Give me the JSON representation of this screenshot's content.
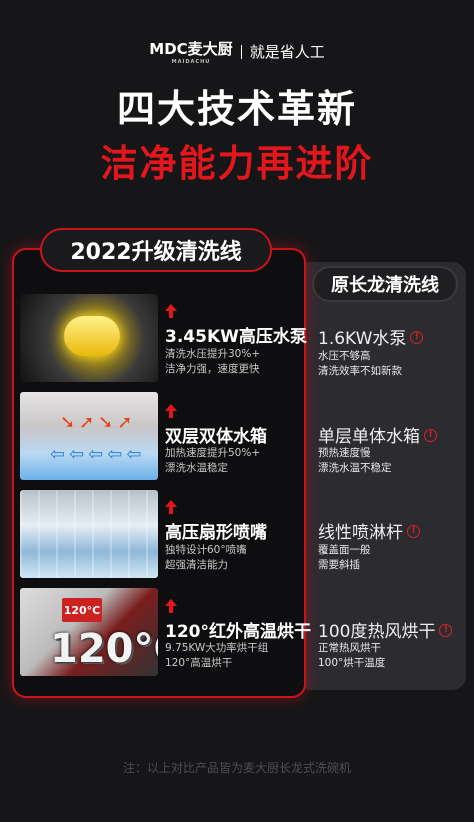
{
  "brand": {
    "logo": "MDC麦大厨",
    "logo_sub": "MAIDACHU",
    "slogan": "就是省人工"
  },
  "headline": {
    "line1": "四大技术革新",
    "line2": "洁净能力再进阶"
  },
  "new_line": {
    "label": "2022升级清洗线",
    "items": [
      {
        "title": "3.45KW高压水泵",
        "sub1": "清洗水压提升30%+",
        "sub2": "洁净力强，速度更快"
      },
      {
        "title": "双层双体水箱",
        "sub1": "加热速度提升50%+",
        "sub2": "漂洗水温稳定"
      },
      {
        "title": "高压扇形喷嘴",
        "sub1": "独特设计60°喷嘴",
        "sub2": "超强清洁能力"
      },
      {
        "title": "120°红外高温烘干",
        "sub1": "9.75KW大功率烘干组",
        "sub2": "120°高温烘干"
      }
    ],
    "image_texts": {
      "temp_big": "120°C",
      "temp_small": "120°C"
    }
  },
  "old_line": {
    "label": "原长龙清洗线",
    "items": [
      {
        "title": "1.6KW水泵",
        "sub1": "水压不够高",
        "sub2": "清洗效率不如新款"
      },
      {
        "title": "单层单体水箱",
        "sub1": "预热速度慢",
        "sub2": "漂洗水温不稳定"
      },
      {
        "title": "线性喷淋杆",
        "sub1": "覆盖面一般",
        "sub2": "需要斜插"
      },
      {
        "title": "100度热风烘干",
        "sub1": "正常热风烘干",
        "sub2": "100°烘干温度"
      }
    ]
  },
  "footnote": "注：以上对比产品皆为麦大厨长龙式洗碗机",
  "colors": {
    "accent_red": "#e3161c",
    "background": "#161618"
  },
  "icons": {
    "up": "up-arrow-icon",
    "warning": "warning-icon"
  }
}
